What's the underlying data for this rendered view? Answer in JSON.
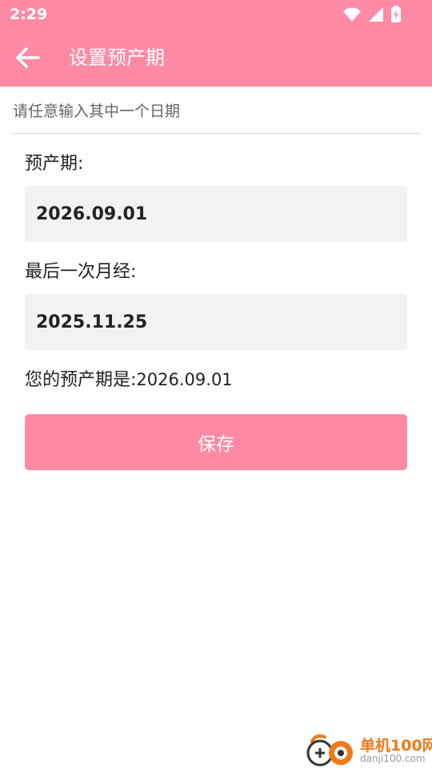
{
  "status_bar": {
    "time": "2:29",
    "icons": [
      "wifi-icon",
      "cell-signal-icon",
      "battery-charging-icon"
    ]
  },
  "app_bar": {
    "title": "设置预产期",
    "back_icon": "arrow-left-icon"
  },
  "form": {
    "hint": "请任意输入其中一个日期",
    "due_date_label": "预产期:",
    "due_date_value": "2026.09.01",
    "last_period_label": "最后一次月经:",
    "last_period_value": "2025.11.25",
    "result_label": "您的预产期是:",
    "result_value": "2026.09.01",
    "save_label": "保存"
  },
  "watermark": {
    "name": "单机100网",
    "url": "danji100.com"
  },
  "colors": {
    "accent": "#ff8aa6",
    "field_bg": "#f2f2f2",
    "text": "#222222",
    "hint": "#666666"
  }
}
